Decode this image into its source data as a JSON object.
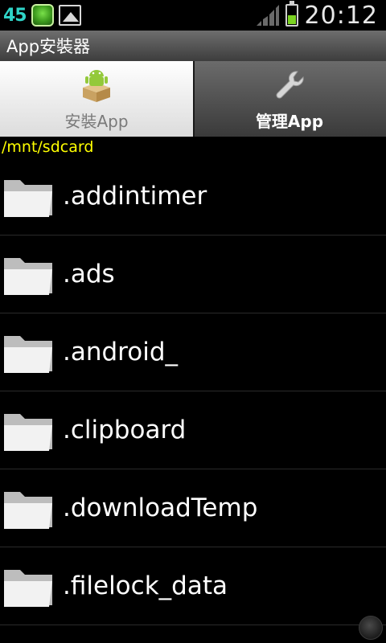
{
  "status_bar": {
    "notification_count": "45",
    "time": "20:12",
    "icons": [
      "app-notification-icon",
      "image-icon",
      "signal-icon",
      "battery-icon"
    ]
  },
  "title": "App安裝器",
  "tabs": [
    {
      "label": "安裝App",
      "icon": "android-box-icon",
      "selected": true
    },
    {
      "label": "管理App",
      "icon": "wrench-icon",
      "selected": false
    }
  ],
  "path": "/mnt/sdcard",
  "files": [
    {
      "name": ".addintimer"
    },
    {
      "name": ".ads"
    },
    {
      "name": ".android_"
    },
    {
      "name": ".clipboard"
    },
    {
      "name": ".downloadTemp"
    },
    {
      "name": ".filelock_data"
    }
  ],
  "colors": {
    "path_text": "#ffff00",
    "status_count": "#2fd3c7",
    "background": "#000000"
  }
}
